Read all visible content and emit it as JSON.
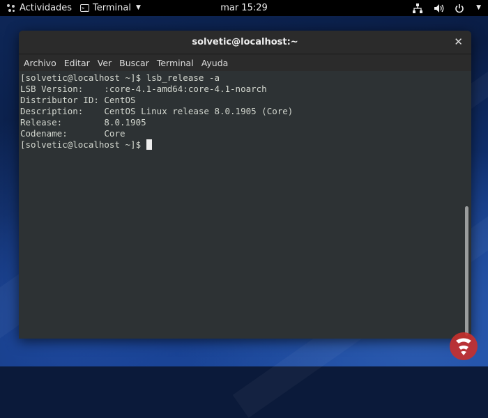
{
  "topbar": {
    "activities_label": "Actividades",
    "app_menu_label": "Terminal",
    "clock": "mar 15:29",
    "icons": [
      "network-icon",
      "volume-icon",
      "power-icon",
      "chevron-down-icon"
    ]
  },
  "window": {
    "title": "solvetic@localhost:~",
    "close_glyph": "✕",
    "menu": [
      "Archivo",
      "Editar",
      "Ver",
      "Buscar",
      "Terminal",
      "Ayuda"
    ]
  },
  "terminal": {
    "lines": [
      "[solvetic@localhost ~]$ lsb_release -a",
      "LSB Version:    :core-4.1-amd64:core-4.1-noarch",
      "Distributor ID: CentOS",
      "Description:    CentOS Linux release 8.0.1905 (Core)",
      "Release:        8.0.1905",
      "Codename:       Core"
    ],
    "prompt": "[solvetic@localhost ~]$ "
  },
  "colors": {
    "terminal_bg": "#2d3234",
    "terminal_fg": "#d3d7cf",
    "topbar_bg": "#000000"
  }
}
